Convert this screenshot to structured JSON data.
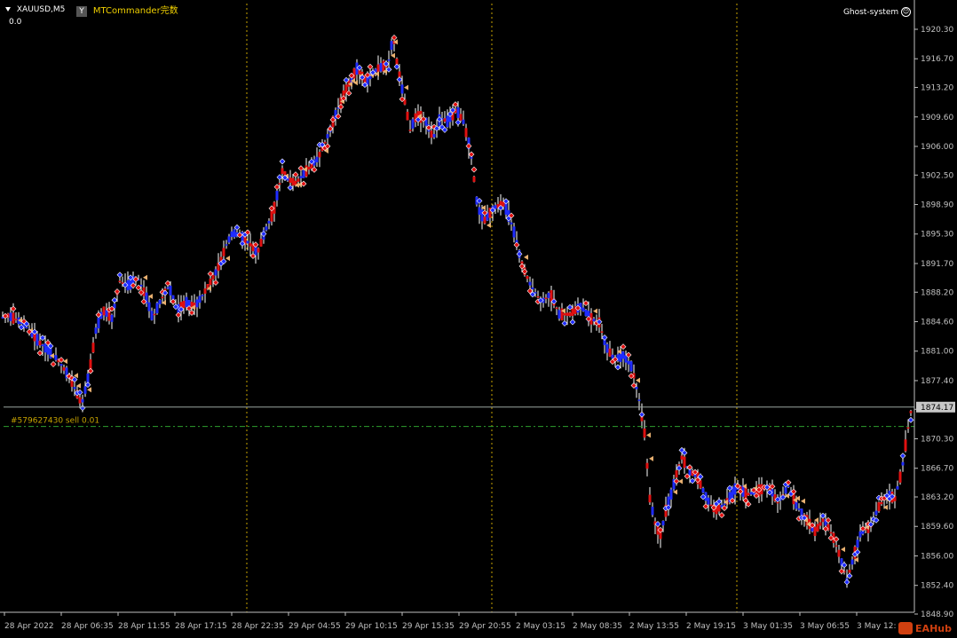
{
  "header": {
    "symbol_timeframe": "XAUUSD,M5",
    "indicator_value": "0.0",
    "plugin_name": "MTCommander完数",
    "plugin_icon_letter": "Y",
    "system_label": "Ghost-system",
    "smiley_icon": "smiley-icon"
  },
  "order_line": {
    "label": "#579627430 sell 0.01",
    "price": 1871.8
  },
  "current_price": {
    "label": "1874.17",
    "value": 1874.17
  },
  "watermark": {
    "text": "EAHub",
    "icon": "eahub-logo-icon"
  },
  "colors": {
    "background": "#000000",
    "axis": "#c0c0c0",
    "grid": "#c8a400",
    "bull": "#1f2cff",
    "bear": "#e01010",
    "wick": "#ffffff",
    "order_line": "#2e9e2e",
    "order_label": "#c8a400",
    "price_line": "#9aa5a0",
    "price_badge_bg": "#c8c8c8"
  },
  "chart_data": {
    "type": "line",
    "title": "",
    "xlabel": "",
    "ylabel": "",
    "ylim": [
      1847.3,
      1922.8
    ],
    "y_ticks": [
      "1920.30",
      "1916.70",
      "1913.20",
      "1909.60",
      "1906.00",
      "1902.50",
      "1898.90",
      "1895.30",
      "1891.70",
      "1888.20",
      "1884.60",
      "1881.00",
      "1877.40",
      "1873.90",
      "1870.30",
      "1866.70",
      "1863.20",
      "1859.60",
      "1856.00",
      "1852.40",
      "1848.90"
    ],
    "x_ticks": [
      "28 Apr 2022",
      "28 Apr 06:35",
      "28 Apr 11:55",
      "28 Apr 17:15",
      "28 Apr 22:35",
      "29 Apr 04:55",
      "29 Apr 10:15",
      "29 Apr 15:35",
      "29 Apr 20:55",
      "2 May 03:15",
      "2 May 08:35",
      "2 May 13:55",
      "2 May 19:15",
      "3 May 01:35",
      "3 May 06:55",
      "3 May 12:"
    ],
    "series": [
      {
        "x": [
          0,
          1,
          2,
          3,
          4,
          5,
          6,
          7,
          8,
          9,
          10,
          11,
          12,
          13,
          14,
          15
        ],
        "values": [
          1884.8,
          1884.0,
          1877.5,
          1874.5,
          1888.5,
          1891.0,
          1885.5,
          1890.0,
          1896.0,
          1893.5,
          1900.0,
          1905.5,
          1911.0,
          1916.0,
          1917.5,
          1912.5
        ],
        "x2": [
          16,
          17,
          18,
          19,
          20,
          21,
          22,
          23,
          24,
          25,
          26,
          27,
          28,
          29,
          30
        ],
        "values2": [
          1909.0,
          1907.0,
          1909.5,
          1904.0,
          1896.5,
          1897.5,
          1891.5,
          1888.5,
          1886.5,
          1884.5,
          1880.5,
          1871.0,
          1860.0,
          1862.0,
          1869.5
        ]
      }
    ],
    "path": [
      [
        0,
        1884.8
      ],
      [
        6,
        1885.5
      ],
      [
        25,
        1884.5
      ],
      [
        45,
        1882.0
      ],
      [
        65,
        1880.0
      ],
      [
        80,
        1877.5
      ],
      [
        92,
        1874.5
      ],
      [
        100,
        1878.0
      ],
      [
        108,
        1883.5
      ],
      [
        116,
        1886.0
      ],
      [
        126,
        1885.0
      ],
      [
        135,
        1889.5
      ],
      [
        145,
        1889.0
      ],
      [
        155,
        1890.0
      ],
      [
        165,
        1887.5
      ],
      [
        172,
        1885.0
      ],
      [
        180,
        1887.0
      ],
      [
        190,
        1889.0
      ],
      [
        200,
        1886.0
      ],
      [
        210,
        1887.0
      ],
      [
        220,
        1886.5
      ],
      [
        232,
        1888.5
      ],
      [
        245,
        1891.0
      ],
      [
        255,
        1894.0
      ],
      [
        262,
        1895.5
      ],
      [
        272,
        1895.0
      ],
      [
        282,
        1894.0
      ],
      [
        290,
        1893.0
      ],
      [
        298,
        1895.5
      ],
      [
        308,
        1898.0
      ],
      [
        318,
        1903.0
      ],
      [
        325,
        1902.0
      ],
      [
        333,
        1901.5
      ],
      [
        345,
        1903.0
      ],
      [
        358,
        1904.5
      ],
      [
        370,
        1907.5
      ],
      [
        380,
        1910.5
      ],
      [
        392,
        1913.5
      ],
      [
        402,
        1915.5
      ],
      [
        412,
        1914.0
      ],
      [
        425,
        1915.5
      ],
      [
        437,
        1916.0
      ],
      [
        443,
        1919.5
      ],
      [
        448,
        1915.5
      ],
      [
        455,
        1912.0
      ],
      [
        462,
        1908.0
      ],
      [
        470,
        1910.0
      ],
      [
        480,
        1909.0
      ],
      [
        488,
        1907.0
      ],
      [
        496,
        1909.5
      ],
      [
        505,
        1909.0
      ],
      [
        514,
        1910.5
      ],
      [
        522,
        1909.0
      ],
      [
        530,
        1905.5
      ],
      [
        538,
        1898.5
      ],
      [
        546,
        1897.0
      ],
      [
        556,
        1898.5
      ],
      [
        568,
        1899.0
      ],
      [
        578,
        1896.0
      ],
      [
        588,
        1891.5
      ],
      [
        598,
        1889.0
      ],
      [
        610,
        1887.0
      ],
      [
        620,
        1888.0
      ],
      [
        630,
        1885.5
      ],
      [
        642,
        1885.5
      ],
      [
        654,
        1886.5
      ],
      [
        665,
        1885.0
      ],
      [
        675,
        1884.5
      ],
      [
        683,
        1881.5
      ],
      [
        692,
        1880.0
      ],
      [
        702,
        1880.5
      ],
      [
        712,
        1879.0
      ],
      [
        720,
        1875.0
      ],
      [
        726,
        1871.0
      ],
      [
        732,
        1863.0
      ],
      [
        738,
        1860.0
      ],
      [
        744,
        1858.5
      ],
      [
        750,
        1861.5
      ],
      [
        756,
        1863.5
      ],
      [
        762,
        1866.0
      ],
      [
        768,
        1868.0
      ],
      [
        776,
        1866.5
      ],
      [
        786,
        1865.5
      ],
      [
        796,
        1863.0
      ],
      [
        806,
        1861.5
      ],
      [
        818,
        1862.5
      ],
      [
        830,
        1864.5
      ],
      [
        842,
        1863.5
      ],
      [
        855,
        1864.0
      ],
      [
        866,
        1864.5
      ],
      [
        876,
        1862.5
      ],
      [
        888,
        1864.5
      ],
      [
        898,
        1862.0
      ],
      [
        908,
        1860.5
      ],
      [
        918,
        1859.0
      ],
      [
        928,
        1860.5
      ],
      [
        938,
        1858.5
      ],
      [
        946,
        1856.0
      ],
      [
        954,
        1853.0
      ],
      [
        962,
        1856.0
      ],
      [
        970,
        1859.0
      ],
      [
        980,
        1859.5
      ],
      [
        990,
        1862.0
      ],
      [
        1000,
        1863.5
      ],
      [
        1008,
        1863.0
      ],
      [
        1016,
        1866.5
      ],
      [
        1022,
        1871.0
      ],
      [
        1027,
        1874.2
      ]
    ]
  }
}
